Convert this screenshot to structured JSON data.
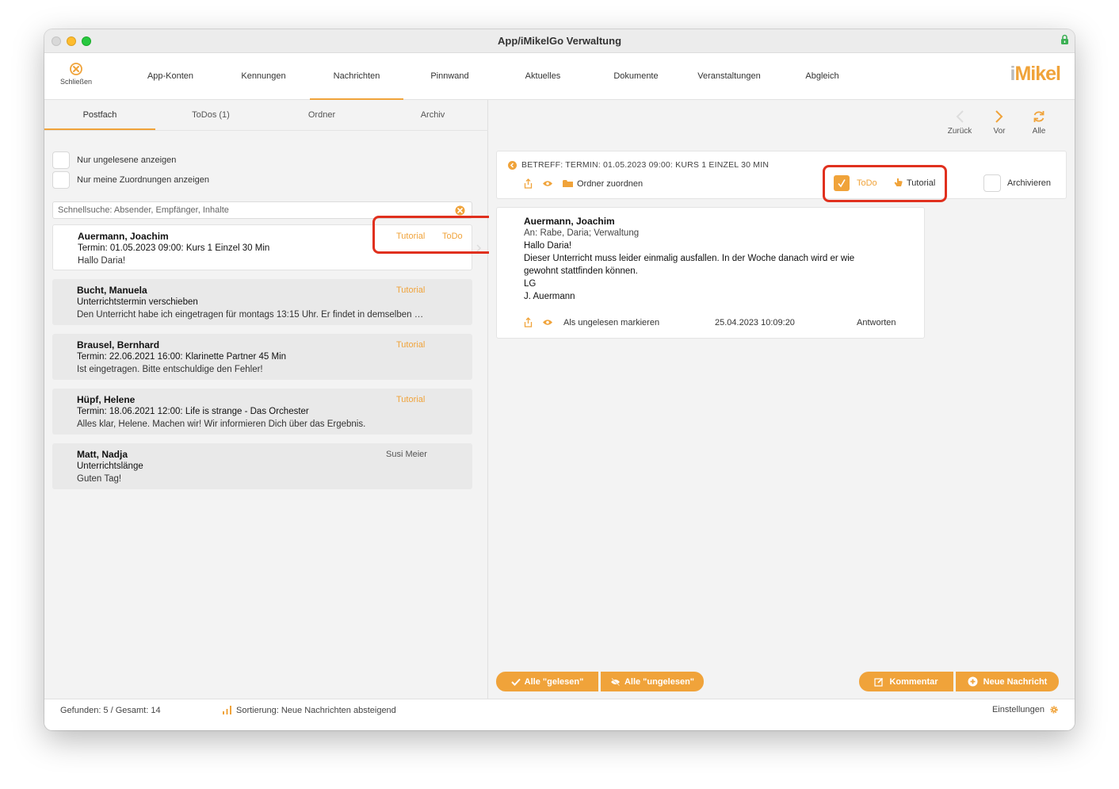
{
  "window": {
    "title": "App/iMikelGo Verwaltung"
  },
  "toolbar": {
    "close_label": "Schließen",
    "tabs": [
      "App-Konten",
      "Kennungen",
      "Nachrichten",
      "Pinnwand",
      "Aktuelles",
      "Dokumente",
      "Veranstaltungen",
      "Abgleich"
    ],
    "active_tab": "Nachrichten",
    "logo_i": "i",
    "logo_rest": "Mikel"
  },
  "left": {
    "subtabs": [
      "Postfach",
      "ToDos (1)",
      "Ordner",
      "Archiv"
    ],
    "active_subtab": "Postfach",
    "filters": [
      "Nur ungelesene anzeigen",
      "Nur meine Zuordnungen anzeigen"
    ],
    "search_placeholder": "Schnellsuche: Absender, Empfänger, Inhalte",
    "messages": [
      {
        "sender": "Auermann, Joachim",
        "subject": "Termin: 01.05.2023 09:00: Kurs 1 Einzel 30 Min",
        "preview": "Hallo Daria!",
        "tags": [
          "Tutorial",
          "ToDo"
        ],
        "selected": true
      },
      {
        "sender": "Bucht, Manuela",
        "subject": "Unterrichtstermin verschieben",
        "preview": "Den Unterricht habe ich eingetragen für montags 13:15 Uhr. Er findet in demselben …",
        "tags": [
          "Tutorial"
        ]
      },
      {
        "sender": "Brausel, Bernhard",
        "subject": "Termin: 22.06.2021 16:00: Klarinette Partner 45 Min",
        "preview": "Ist eingetragen. Bitte entschuldige den Fehler!",
        "tags": [
          "Tutorial"
        ]
      },
      {
        "sender": "Hüpf, Helene",
        "subject": "Termin: 18.06.2021 12:00: Life is strange - Das Orchester",
        "preview": "Alles klar, Helene. Machen wir! Wir informieren Dich über das Ergebnis.",
        "tags": [
          "Tutorial"
        ]
      },
      {
        "sender": "Matt, Nadja",
        "subject": "Unterrichtslänge",
        "preview": "Guten Tag!",
        "tags": [
          "Susi Meier"
        ]
      }
    ]
  },
  "right": {
    "nav": {
      "back": "Zurück",
      "forward": "Vor",
      "all": "Alle"
    },
    "subject_line": "BETREFF: TERMIN: 01.05.2023 09:00: KURS 1 EINZEL 30 MIN",
    "folder_assign": "Ordner zuordnen",
    "todo_label": "ToDo",
    "todo_checked": true,
    "tutorial_label": "Tutorial",
    "archive_label": "Archivieren",
    "message": {
      "sender": "Auermann, Joachim",
      "recipients": "An: Rabe, Daria; Verwaltung",
      "body": [
        "Hallo Daria!",
        "Dieser Unterricht muss leider einmalig ausfallen. In der Woche danach wird er wie",
        "gewohnt stattfinden können.",
        "LG",
        "J. Auermann"
      ],
      "mark_unread": "Als ungelesen markieren",
      "timestamp": "25.04.2023 10:09:20",
      "reply": "Antworten"
    },
    "buttons": {
      "all_read": "Alle \"gelesen\"",
      "all_unread": "Alle \"ungelesen\"",
      "comment": "Kommentar",
      "new_message": "Neue Nachricht"
    }
  },
  "status": {
    "found": "Gefunden: 5 / Gesamt: 14",
    "sort": "Sortierung: Neue Nachrichten absteigend",
    "settings": "Einstellungen"
  },
  "colors": {
    "accent": "#f0a33a",
    "highlight": "#e0301e",
    "panel": "#f3f3f3"
  }
}
